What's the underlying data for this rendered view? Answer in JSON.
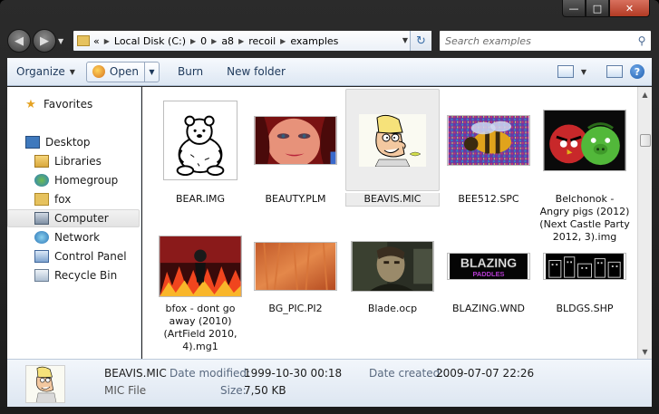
{
  "window": {
    "caption_icons": [
      "minimize-icon",
      "maximize-icon",
      "close-icon"
    ]
  },
  "nav": {
    "back_icon": "back-arrow-icon",
    "forward_icon": "forward-arrow-icon",
    "prefix": "«",
    "crumbs": [
      "Local Disk (C:)",
      "0",
      "a8",
      "recoil",
      "examples"
    ],
    "search_placeholder": "Search examples"
  },
  "toolbar": {
    "organize": "Organize",
    "open": "Open",
    "burn": "Burn",
    "new_folder": "New folder"
  },
  "sidebar": {
    "items": [
      {
        "label": "Favorites",
        "icon": "star-icon"
      },
      {
        "label": "Desktop",
        "icon": "desktop-icon"
      },
      {
        "label": "Libraries",
        "icon": "libraries-icon"
      },
      {
        "label": "Homegroup",
        "icon": "homegroup-icon"
      },
      {
        "label": "fox",
        "icon": "folder-icon"
      },
      {
        "label": "Computer",
        "icon": "computer-icon",
        "selected": true
      },
      {
        "label": "Network",
        "icon": "network-icon"
      },
      {
        "label": "Control Panel",
        "icon": "control-panel-icon"
      },
      {
        "label": "Recycle Bin",
        "icon": "recycle-bin-icon"
      }
    ]
  },
  "files": [
    {
      "name": "BEAR.IMG"
    },
    {
      "name": "BEAUTY.PLM"
    },
    {
      "name": "BEAVIS.MIC",
      "selected": true
    },
    {
      "name": "BEE512.SPC"
    },
    {
      "name": "Belchonok - Angry pigs (2012) (Next Castle Party 2012, 3).img"
    },
    {
      "name": "bfox - dont go away (2010) (ArtField 2010, 4).mg1"
    },
    {
      "name": "BG_PIC.PI2"
    },
    {
      "name": "Blade.ocp"
    },
    {
      "name": "BLAZING.WND",
      "thumb_text": "BLAZING",
      "thumb_subtext": "PADDLES"
    },
    {
      "name": "BLDGS.SHP"
    }
  ],
  "details": {
    "name": "BEAVIS.MIC",
    "type": "MIC File",
    "modified_label": "Date modified:",
    "modified_value": "1999-10-30 00:18",
    "created_label": "Date created:",
    "created_value": "2009-07-07 22:26",
    "size_label": "Size:",
    "size_value": "7,50 KB"
  }
}
